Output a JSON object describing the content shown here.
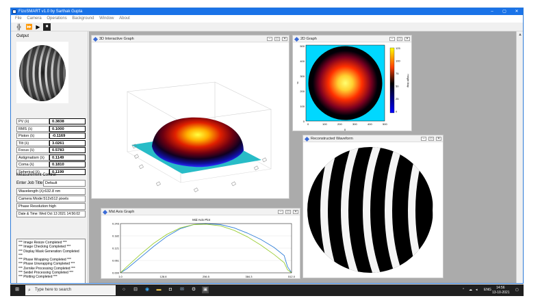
{
  "window": {
    "title": "FizoSMART v1.0 by Sarthak Gupta",
    "controls": [
      "–",
      "▢",
      "✕"
    ]
  },
  "menu": [
    "File",
    "Camera",
    "Operations",
    "Background",
    "Window",
    "About"
  ],
  "toolbar": {
    "tools": [
      "crosshair-tool",
      "fast-forward",
      "play",
      "save"
    ],
    "glyphs": [
      "╬",
      "⏩",
      "▶",
      "💾"
    ]
  },
  "left": {
    "output_label": "Output",
    "metrics": [
      {
        "label": "PV (λ)",
        "value": "0.3838"
      },
      {
        "label": "RMS (λ)",
        "value": "0.1000"
      },
      {
        "label": "Piston (λ)",
        "value": "-0.1169"
      },
      {
        "label": "Tilt (λ)",
        "value": "3.0261"
      },
      {
        "label": "Focus (λ)",
        "value": "0.5783"
      },
      {
        "label": "Astigmatism (λ)",
        "value": "0.1149"
      },
      {
        "label": "Coma (λ)",
        "value": "0.1810"
      },
      {
        "label": "Spherical (λ)",
        "value": "0.1199"
      }
    ],
    "measurement_control": "Measurement Control",
    "job_title_label": "Enter Job Title",
    "job_title_value": "Default",
    "wavelength": "Wavelength (λ):632.8 nm",
    "camera_mode": "Camera Mode:512x512 pixels",
    "phase_resolution": "Phase Resolution:high",
    "datetime": "Date & Time: Wed Oct 13 2021 14:56:02",
    "log": [
      "*** Image Resize Completed ***",
      "*** Image Checking Completed ***",
      "*** Display Mask Generation Completed ***",
      "*** Phase Wrapping Completed ***",
      "*** Phase Unwrapping Completed ***",
      "*** Zernike Processing Completed ***",
      "*** Seidel Processing Completed ***",
      "*** Plotting Completed ***"
    ],
    "progress_text": "0%",
    "progress_fraction": 0
  },
  "subwindows": {
    "graph3d": "3D Interactive Graph",
    "graph2d": "2D Graph",
    "midaxis": "Mid Axis Graph",
    "recon": "Reconstructed Waveform"
  },
  "graph2d": {
    "x_label": "x",
    "y_label": "y",
    "x_ticks": [
      "0",
      "100",
      "200",
      "300",
      "400",
      "500"
    ],
    "y_ticks": [
      "500",
      "400",
      "300",
      "200",
      "100",
      "0"
    ],
    "colorbar_label": "Height Map",
    "colorbar_ticks": [
      "125",
      "100",
      "75",
      "50",
      "25",
      "0"
    ],
    "colors": [
      "#0000ff",
      "#000000",
      "#ff0000",
      "#ffff00"
    ]
  },
  "chart_data": {
    "type": "line",
    "title": "Mid Axis Plot",
    "xlim": [
      1.0,
      512.0
    ],
    "ylim": [
      0.0,
      0.243
    ],
    "x_ticks": [
      "1.0",
      "128.8",
      "256.5",
      "384.3",
      "512.0"
    ],
    "y_ticks": [
      "0.243",
      "0.182",
      "0.121",
      "0.061",
      "0.000"
    ],
    "series": [
      {
        "color": "#2e7dd7",
        "x": [
          1,
          20,
          60,
          100,
          140,
          180,
          220,
          256,
          300,
          340,
          380,
          420,
          460,
          490,
          500,
          512
        ],
        "y": [
          0.0,
          0.02,
          0.075,
          0.13,
          0.18,
          0.218,
          0.238,
          0.243,
          0.238,
          0.222,
          0.196,
          0.165,
          0.125,
          0.085,
          0.03,
          0.0
        ]
      },
      {
        "color": "#9acd32",
        "x": [
          1,
          20,
          60,
          100,
          140,
          180,
          220,
          256,
          300,
          340,
          380,
          420,
          460,
          490,
          500,
          512
        ],
        "y": [
          0.0,
          0.03,
          0.09,
          0.145,
          0.19,
          0.222,
          0.238,
          0.24,
          0.232,
          0.21,
          0.178,
          0.137,
          0.09,
          0.05,
          0.015,
          0.0
        ]
      }
    ]
  },
  "taskbar": {
    "search_placeholder": "Type here to search",
    "tray_lang": "ENG",
    "time": "14:56",
    "date": "13-10-2021"
  }
}
